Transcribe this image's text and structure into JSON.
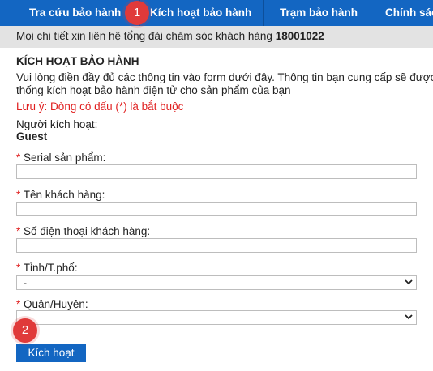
{
  "nav": {
    "tabs": [
      {
        "label": "Tra cứu bảo hành"
      },
      {
        "label": "Kích hoạt bảo hành"
      },
      {
        "label": "Trạm bảo hành"
      },
      {
        "label": "Chính sác"
      }
    ]
  },
  "contact": {
    "text": "Mọi chi tiết xin liên hệ tổng đài chăm sóc khách hàng",
    "hotline": "18001022"
  },
  "form": {
    "heading": "KÍCH HOẠT BẢO HÀNH",
    "intro": "Vui lòng điền đầy đủ các thông tin vào form dưới đây. Thông tin bạn cung cấp sẽ được h thống kích hoạt bảo hành điện tử cho sản phẩm của bạn",
    "note": "Lưu ý: Dòng có dấu (*) là bắt buộc",
    "activator_label": "Người kích hoạt:",
    "activator_value": "Guest",
    "required_mark": "*",
    "serial_label": "Serial sản phẩm:",
    "serial_value": "",
    "customer_name_label": "Tên khách hàng:",
    "customer_name_value": "",
    "phone_label": "Số điện thoại khách hàng:",
    "phone_value": "",
    "province_label": "Tỉnh/T.phố:",
    "province_selected": "-",
    "district_label": "Quận/Huyện:",
    "district_selected": "",
    "submit_label": "Kích hoạt"
  },
  "annotations": {
    "badge_1": "1",
    "badge_2": "2"
  },
  "colors": {
    "nav_bg": "#1366c2",
    "required": "#e02020",
    "badge": "#e03a3a"
  },
  "icons": {
    "select_arrow": "chevron-down-icon"
  }
}
